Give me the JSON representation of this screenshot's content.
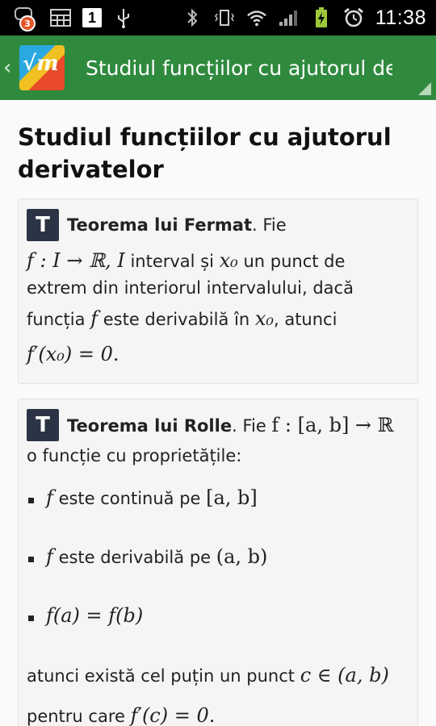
{
  "status_bar": {
    "notification_count": "3",
    "calendar_day": "1",
    "time": "11:38"
  },
  "action_bar": {
    "back_glyph": "‹",
    "title": "Studiul funcțiilor cu ajutorul der",
    "logo_mark": "√m"
  },
  "page": {
    "title_line1": "Studiul funcțiilor cu ajutorul",
    "title_line2": "derivatelor"
  },
  "fermat": {
    "badge": "T",
    "heading": "Teorema lui Fermat",
    "after_heading": ". Fie",
    "l2_math": "f : I → ℝ,  I",
    "l2_text": " interval și ",
    "l2_x0": "x₀",
    "l2_tail": " un punct de",
    "l3": "extrem din interiorul intervalului, dacă",
    "l4_a": "funcția ",
    "l4_f": "f",
    "l4_b": " este derivabilă în ",
    "l4_x0": "x₀",
    "l4_c": ", atunci",
    "l5": "f′(x₀) = 0."
  },
  "rolle": {
    "badge": "T",
    "heading": "Teorema lui Rolle",
    "after_heading": ". Fie ",
    "l1_math": "f : [a, b] → ℝ",
    "l2": "o funcție cu proprietățile:",
    "bullets": [
      {
        "math": "f",
        "text": " este continuă pe ",
        "math2": "[a, b]"
      },
      {
        "math": "f",
        "text": " este derivabilă pe ",
        "math2": "(a, b)"
      },
      {
        "math": "f(a) = f(b)",
        "text": "",
        "math2": ""
      }
    ],
    "concl_a": "atunci există cel puțin un punct ",
    "concl_math": "c ∈ (a, b)",
    "concl2_a": "pentru care ",
    "concl2_math": "f′(c) = 0."
  },
  "colors": {
    "action_bar": "#2f8a3e",
    "badge_bg": "#2b3444",
    "status_bar": "#000000"
  }
}
